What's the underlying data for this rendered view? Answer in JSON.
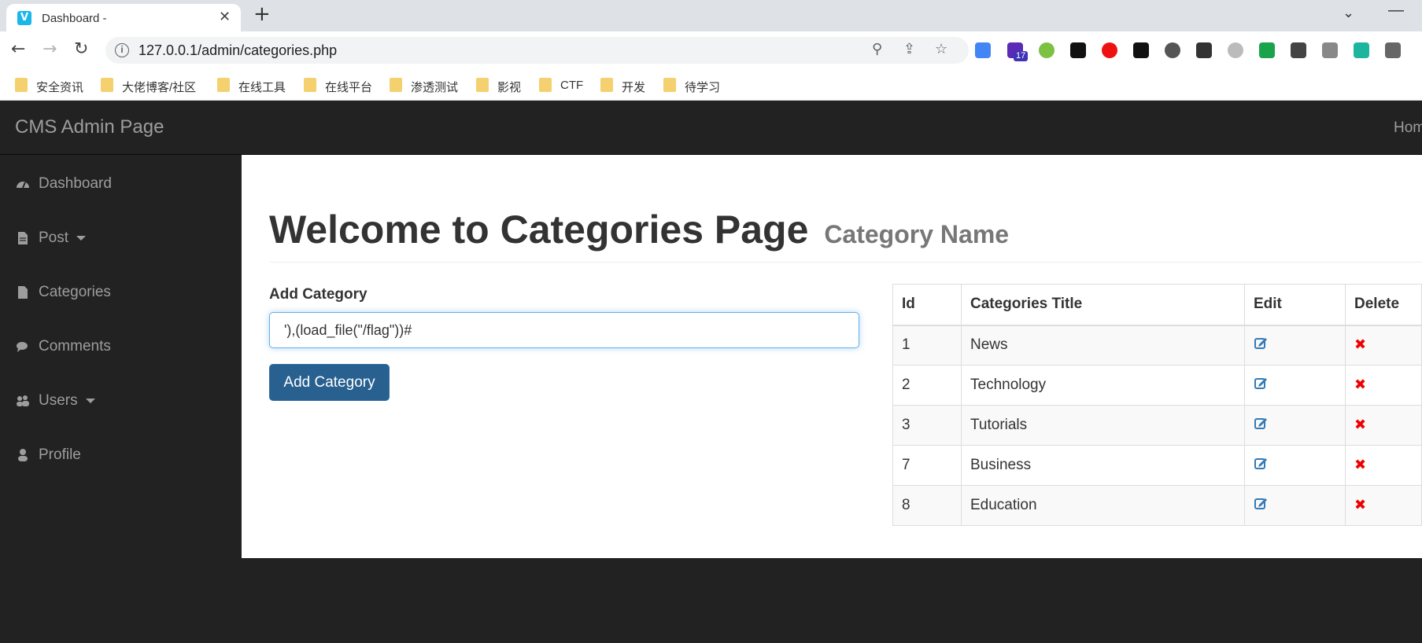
{
  "browser": {
    "tab_title": "Dashboard -",
    "tab_favicon": "V",
    "url": "127.0.0.1/admin/categories.php",
    "extension_badge": "17",
    "bookmarks": [
      "安全资讯",
      "大佬博客/社区",
      "在线工具",
      "在线平台",
      "渗透测试",
      "影视",
      "CTF",
      "开发",
      "待学习"
    ]
  },
  "navbar": {
    "brand": "CMS Admin Page",
    "home_link": "Home"
  },
  "sidebar": {
    "items": [
      {
        "label": "Dashboard",
        "icon": "dashboard-icon"
      },
      {
        "label": "Post",
        "icon": "file-icon",
        "dropdown": true
      },
      {
        "label": "Categories",
        "icon": "file-icon"
      },
      {
        "label": "Comments",
        "icon": "comments-icon"
      },
      {
        "label": "Users",
        "icon": "users-icon",
        "dropdown": true
      },
      {
        "label": "Profile",
        "icon": "user-icon"
      }
    ]
  },
  "main": {
    "heading": "Welcome to Categories Page",
    "subheading": "Category Name",
    "form": {
      "label": "Add Category",
      "input_value": "'),(load_file(\"/flag\"))#",
      "submit_label": "Add Category"
    },
    "table": {
      "headers": [
        "Id",
        "Categories Title",
        "Edit",
        "Delete"
      ],
      "rows": [
        {
          "id": "1",
          "title": "News"
        },
        {
          "id": "2",
          "title": "Technology"
        },
        {
          "id": "3",
          "title": "Tutorials"
        },
        {
          "id": "7",
          "title": "Business"
        },
        {
          "id": "8",
          "title": "Education"
        }
      ]
    }
  },
  "colors": {
    "navbar_bg": "#222222",
    "primary_button": "#286090",
    "delete_icon": "#ee0000",
    "edit_icon": "#337ab7"
  }
}
